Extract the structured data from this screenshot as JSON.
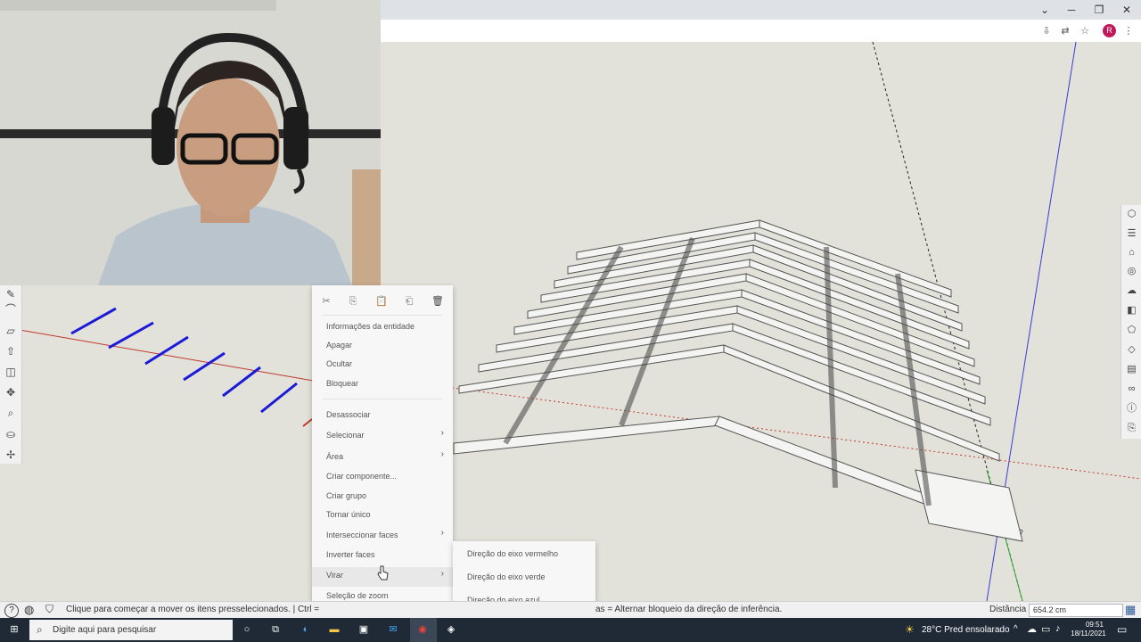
{
  "context_menu": {
    "items": [
      {
        "label": "Informações da entidade",
        "has_submenu": false
      },
      {
        "label": "Apagar",
        "has_submenu": false
      },
      {
        "label": "Ocultar",
        "has_submenu": false
      },
      {
        "label": "Bloquear",
        "has_submenu": false
      },
      {
        "label": "Desassociar",
        "has_submenu": false
      },
      {
        "label": "Selecionar",
        "has_submenu": true
      },
      {
        "label": "Área",
        "has_submenu": true
      },
      {
        "label": "Criar componente...",
        "has_submenu": false
      },
      {
        "label": "Criar grupo",
        "has_submenu": false
      },
      {
        "label": "Tornar único",
        "has_submenu": false
      },
      {
        "label": "Interseccionar faces",
        "has_submenu": true
      },
      {
        "label": "Inverter faces",
        "has_submenu": false
      },
      {
        "label": "Virar",
        "has_submenu": true
      },
      {
        "label": "Seleção de zoom",
        "has_submenu": false
      }
    ],
    "submenu_virar": [
      "Direção do eixo vermelho",
      "Direção do eixo verde",
      "Direção do eixo azul"
    ]
  },
  "status": {
    "hint": "Clique para começar a mover os itens presselecionados.  |  Ctrl =",
    "hint_right": "as = Alternar bloqueio da direção de inferência.",
    "distance_label": "Distância",
    "distance_value": "654.2 cm"
  },
  "taskbar": {
    "search_placeholder": "Digite aqui para pesquisar",
    "weather": "28°C  Pred ensolarado",
    "time": "09:51",
    "date": "18/11/2021"
  },
  "browser": {
    "avatar_letter": "R"
  },
  "colors": {
    "viewport_bg": "#e2e2db",
    "axis_red": "#c0392b",
    "axis_blue": "#3a3ad6",
    "axis_green": "#2ea82e",
    "selection_blue": "#1a1ad8",
    "taskbar_bg": "#1f2a36"
  }
}
